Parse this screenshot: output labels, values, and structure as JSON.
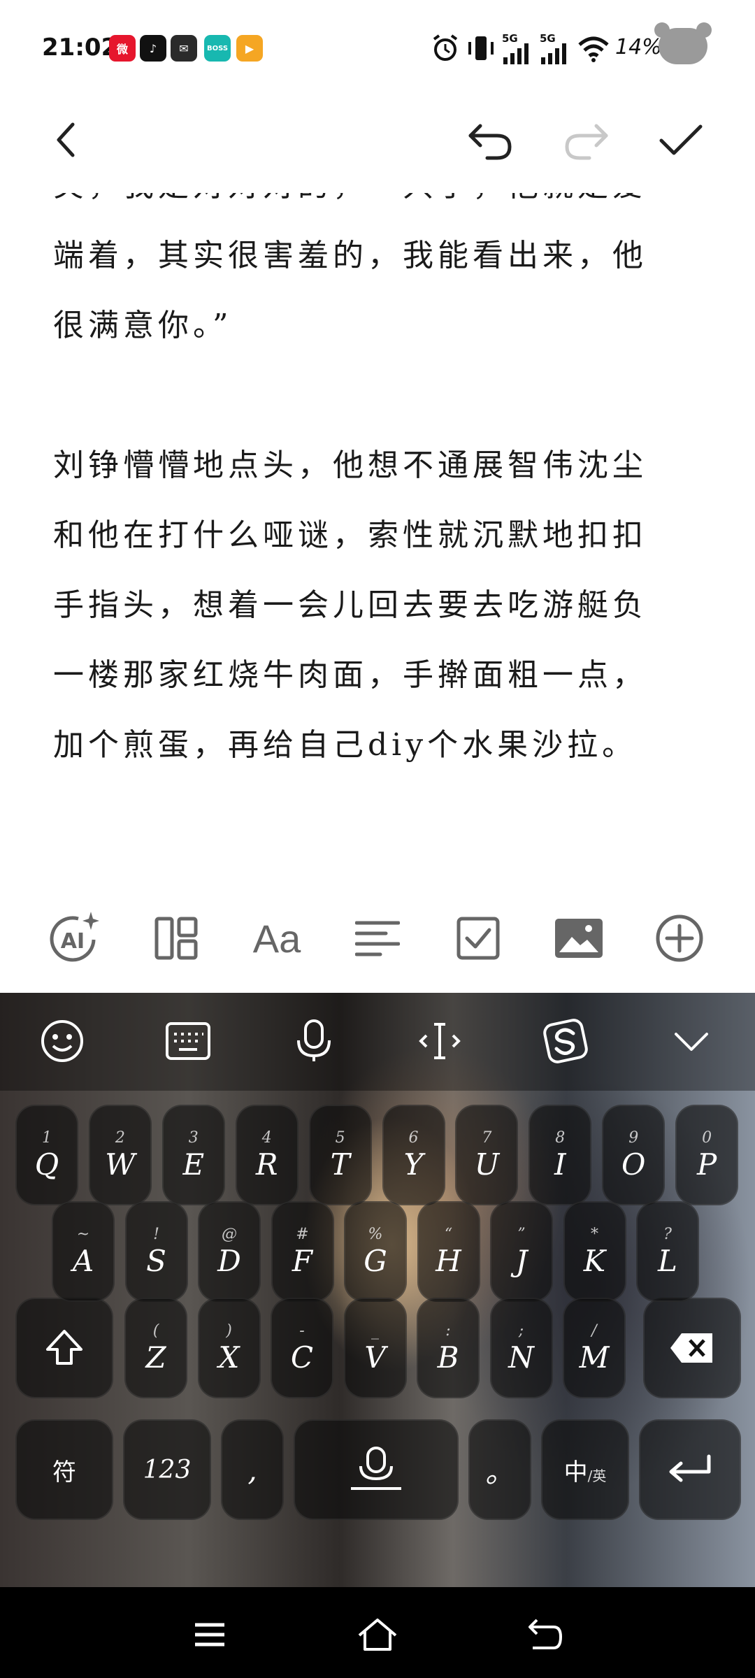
{
  "status_bar": {
    "time": "21:02",
    "apps": [
      {
        "name": "weibo-icon",
        "color": "#e6162d",
        "label": "微"
      },
      {
        "name": "douyin-icon",
        "color": "#111111",
        "label": "♪"
      },
      {
        "name": "wechat-icon",
        "color": "#2a2a2a",
        "label": "✉"
      },
      {
        "name": "boss-icon",
        "color": "#18b8b0",
        "label": "BOSS"
      },
      {
        "name": "video-app-icon",
        "color": "#f5a623",
        "label": "▶"
      }
    ],
    "signal_label_1": "5G",
    "signal_label_2": "5G",
    "battery": "14%"
  },
  "toolbar": {
    "back": "back-arrow-icon",
    "undo": "undo-icon",
    "redo": "redo-icon",
    "confirm": "checkmark-icon",
    "redo_color": "#c8c8c8"
  },
  "document": {
    "cut_line": "笑，我是对对对的，一只手，他就是爱",
    "paragraphs": [
      {
        "lines": [
          "端着，其实很害羞的，我能看出来，他",
          "很满意你。”"
        ]
      },
      {
        "lines": [
          "刘铮懵懵地点头，他想不通展智伟沈尘",
          "和他在打什么哑谜，索性就沉默地扣扣",
          "手指头，想着一会儿回去要去吃游艇负",
          "一楼那家红烧牛肉面，手擀面粗一点，",
          "加个煎蛋，再给自己diy个水果沙拉。"
        ]
      }
    ]
  },
  "format_toolbar": {
    "ai_label": "AI",
    "font_label": "Aa"
  },
  "keyboard": {
    "row1": [
      {
        "sub": "1",
        "main": "Q"
      },
      {
        "sub": "2",
        "main": "W"
      },
      {
        "sub": "3",
        "main": "E"
      },
      {
        "sub": "4",
        "main": "R"
      },
      {
        "sub": "5",
        "main": "T"
      },
      {
        "sub": "6",
        "main": "Y"
      },
      {
        "sub": "7",
        "main": "U"
      },
      {
        "sub": "8",
        "main": "I"
      },
      {
        "sub": "9",
        "main": "O"
      },
      {
        "sub": "0",
        "main": "P"
      }
    ],
    "row2": [
      {
        "sub": "~",
        "main": "A"
      },
      {
        "sub": "!",
        "main": "S"
      },
      {
        "sub": "@",
        "main": "D"
      },
      {
        "sub": "#",
        "main": "F"
      },
      {
        "sub": "%",
        "main": "G"
      },
      {
        "sub": "“",
        "main": "H"
      },
      {
        "sub": "”",
        "main": "J"
      },
      {
        "sub": "*",
        "main": "K"
      },
      {
        "sub": "?",
        "main": "L"
      }
    ],
    "row3": [
      {
        "sub": "(",
        "main": "Z"
      },
      {
        "sub": ")",
        "main": "X"
      },
      {
        "sub": "-",
        "main": "C"
      },
      {
        "sub": "_",
        "main": "V"
      },
      {
        "sub": ":",
        "main": "B"
      },
      {
        "sub": ";",
        "main": "N"
      },
      {
        "sub": "/",
        "main": "M"
      }
    ],
    "symbols_label": "符",
    "numbers_label": "123",
    "comma_label": ",",
    "period_label": "。",
    "lang_label_main": "中",
    "lang_label_sub": "/英"
  }
}
